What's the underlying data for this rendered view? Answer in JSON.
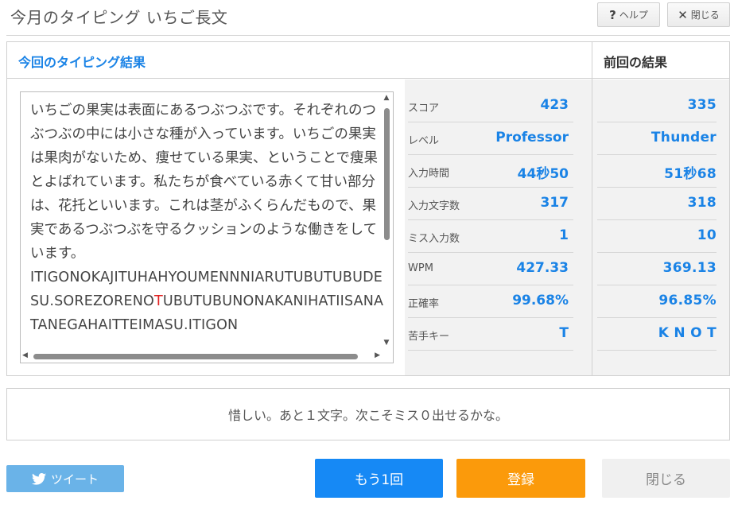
{
  "header": {
    "title": "今月のタイピング いちご長文",
    "help_label": "ヘルプ",
    "help_icon": "?",
    "close_label": "閉じる",
    "close_icon": "✕"
  },
  "results": {
    "current_title": "今回のタイピング結果",
    "previous_title": "前回の結果",
    "text": {
      "japanese": "いちごの果実は表面にあるつぶつぶです。それぞれのつぶつぶの中には小さな種が入っています。いちごの果実は果肉がないため、痩せている果実、ということで痩果とよばれています。私たちが食べている赤くて甘い部分は、花托といいます。これは茎がふくらんだもので、果実であるつぶつぶを守るクッションのような働きをしています。",
      "romaji_before": "ITIGONOKAJITUHAHYOUMENNNIARUTUBUTUBUDESU.SOREZORENO",
      "romaji_miss": "T",
      "romaji_after": "UBUTUBUNONAKANIHATIISANATANEGAHAITTEIMASU.ITIGON"
    },
    "stats": [
      {
        "label": "スコア",
        "current": "423",
        "previous": "335"
      },
      {
        "label": "レベル",
        "current": "Professor",
        "previous": "Thunder"
      },
      {
        "label": "入力時間",
        "current": "44秒50",
        "previous": "51秒68"
      },
      {
        "label": "入力文字数",
        "current": "317",
        "previous": "318"
      },
      {
        "label": "ミス入力数",
        "current": "1",
        "previous": "10"
      },
      {
        "label": "WPM",
        "current": "427.33",
        "previous": "369.13"
      },
      {
        "label": "正確率",
        "current": "99.68%",
        "previous": "96.85%"
      },
      {
        "label": "苦手キー",
        "current": "T",
        "previous": "K N O T"
      }
    ]
  },
  "message": "惜しい。あと１文字。次こそミス０出せるかな。",
  "buttons": {
    "tweet": "ツイート",
    "again": "もう1回",
    "register": "登録",
    "close": "閉じる"
  },
  "colors": {
    "accent_blue": "#1a83e6",
    "again_button": "#1689f5",
    "register_button": "#fb9a0b",
    "tweet_button": "#6ab3e8",
    "miss_char": "#e02020"
  }
}
